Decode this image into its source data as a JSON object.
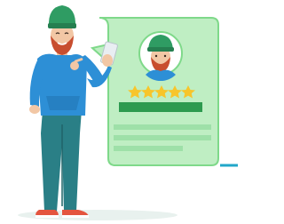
{
  "illustration": {
    "subject": "man-with-phone-giving-review",
    "rating": {
      "stars_filled": 5,
      "stars_total": 5,
      "star_color": "#f7c52b"
    },
    "colors": {
      "card_fill": "#bfeec3",
      "card_outline": "#7fd98a",
      "bar_dark": "#2d9a4f",
      "bar_light": "#9ee0a8",
      "accent_line": "#22a7c9",
      "hat": "#2f9c63",
      "hoodie": "#2d8fd6",
      "jeans": "#2a7f86",
      "shoes": "#e4553f"
    },
    "icons": {
      "avatar": "user-avatar-icon",
      "phone": "smartphone-icon",
      "star": "star-icon"
    }
  }
}
